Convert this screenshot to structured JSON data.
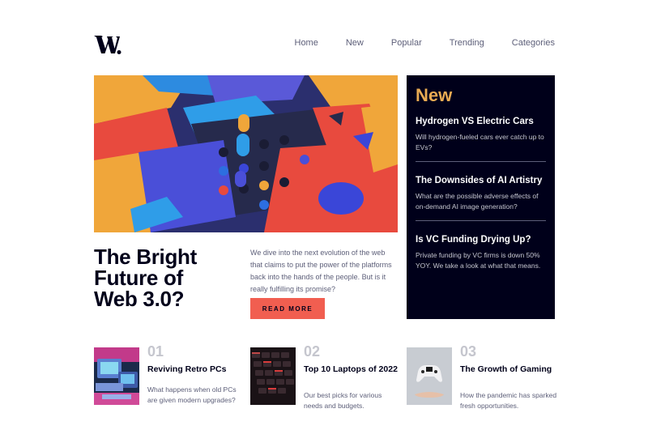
{
  "header": {
    "logo_text": "W.",
    "nav": [
      "Home",
      "New",
      "Popular",
      "Trending",
      "Categories"
    ]
  },
  "hero": {
    "headline": "The Bright Future of Web 3.0?",
    "description": "We dive into the next evolution of the web that claims to put the power of the platforms back into the hands of the people. But is it really fulfilling its promise?",
    "cta": "READ MORE"
  },
  "new_panel": {
    "title": "New",
    "items": [
      {
        "title": "Hydrogen VS Electric Cars",
        "desc": "Will hydrogen-fueled cars ever catch up to EVs?"
      },
      {
        "title": "The Downsides of AI Artistry",
        "desc": "What are the possible adverse effects of on-demand AI image generation?"
      },
      {
        "title": "Is VC Funding Drying Up?",
        "desc": "Private funding by VC firms is down 50% YOY. We take a look at what that means."
      }
    ]
  },
  "cards": [
    {
      "num": "01",
      "title": "Reviving Retro PCs",
      "desc": "What happens when old PCs are given modern upgrades?"
    },
    {
      "num": "02",
      "title": "Top 10 Laptops of 2022",
      "desc": "Our best picks for various needs and budgets."
    },
    {
      "num": "03",
      "title": "The Growth of Gaming",
      "desc": "How the pandemic has sparked fresh opportunities."
    }
  ],
  "colors": {
    "accent_red": "#f15e50",
    "accent_orange": "#e9ab53",
    "dark_navy": "#00001a",
    "grayish_blue": "#5d5f79",
    "grayish_light": "#c5c6ce"
  }
}
